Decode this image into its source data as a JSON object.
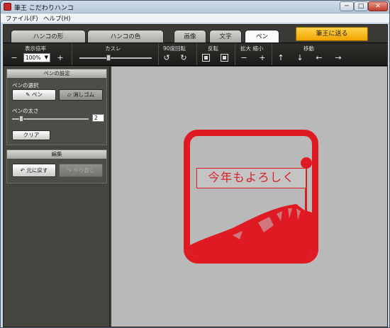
{
  "titlebar": {
    "title": "筆王 こだわりハンコ",
    "min": "─",
    "max": "□",
    "close": "✕"
  },
  "menu": {
    "items": [
      "ファイル(F)",
      "ヘルプ(H)"
    ]
  },
  "tabs": [
    "ハンコの形",
    "ハンコの色",
    "画像",
    "文字",
    "ペン"
  ],
  "active_tab": "ペン",
  "send_button": "筆王に送る",
  "toolbar": {
    "zoom_label": "表示倍率",
    "zoom_value": "100%",
    "zoom_minus": "−",
    "zoom_plus": "+",
    "kasure_label": "カスレ",
    "kasure_level": 0.4,
    "rotate_label": "90度回転",
    "flip_label": "反転",
    "scale_label": "拡大 縮小",
    "scale_minus": "−",
    "scale_plus": "+",
    "move_label": "移動",
    "rotate_left": "↺",
    "rotate_right": "↻",
    "up": "↑",
    "down": "↓",
    "left": "←",
    "right": "→"
  },
  "pen_settings": {
    "header": "ペンの設定",
    "select_label": "ペンの選択",
    "pen_button": "ペン",
    "eraser_button": "消しゴム",
    "thickness_label": "ペンの太さ",
    "thickness_value": "2",
    "thickness_level": 0.1,
    "clear_button": "クリア"
  },
  "edit": {
    "header": "編集",
    "undo_button": "元に戻す",
    "redo_button": "やり直し"
  },
  "stamp": {
    "text": "今年もよろしく",
    "color": "#e01a22"
  }
}
